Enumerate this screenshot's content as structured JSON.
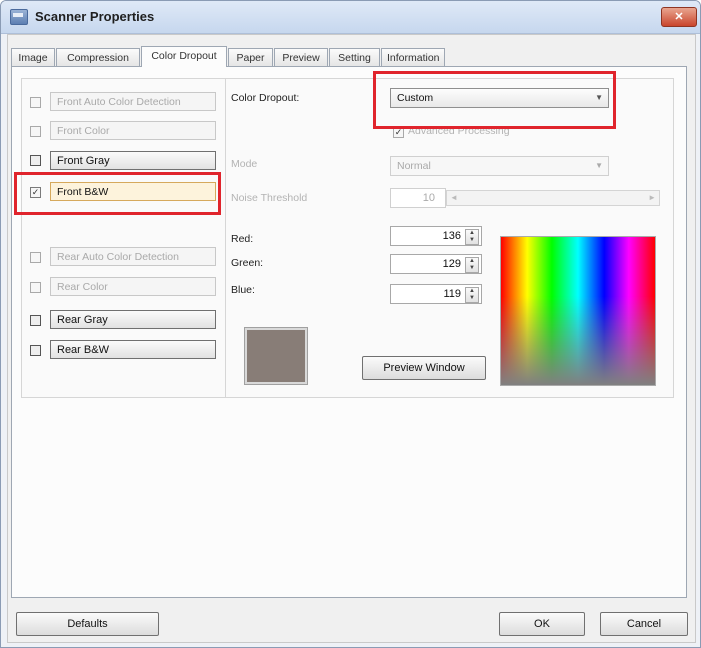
{
  "window": {
    "title": "Scanner Properties",
    "close_glyph": "✕"
  },
  "tabs": [
    {
      "label": "Image"
    },
    {
      "label": "Compression"
    },
    {
      "label": "Color Dropout"
    },
    {
      "label": "Paper"
    },
    {
      "label": "Preview"
    },
    {
      "label": "Setting"
    },
    {
      "label": "Information"
    }
  ],
  "active_tab": "Color Dropout",
  "left_options": [
    {
      "label": "Front Auto Color Detection",
      "checked": false,
      "enabled": false
    },
    {
      "label": "Front Color",
      "checked": false,
      "enabled": false
    },
    {
      "label": "Front Gray",
      "checked": false,
      "enabled": true
    },
    {
      "label": "Front B&W",
      "checked": true,
      "enabled": true,
      "selected": true
    },
    {
      "label": "Rear Auto Color Detection",
      "checked": false,
      "enabled": false
    },
    {
      "label": "Rear Color",
      "checked": false,
      "enabled": false
    },
    {
      "label": "Rear Gray",
      "checked": false,
      "enabled": true
    },
    {
      "label": "Rear B&W",
      "checked": false,
      "enabled": true
    }
  ],
  "checkmark": "✓",
  "dropout": {
    "label": "Color Dropout:",
    "value": "Custom",
    "advanced_label": "Advanced Processing",
    "mode_label": "Mode",
    "mode_value": "Normal",
    "threshold_label": "Noise Threshold",
    "threshold_value": "10"
  },
  "rgb": {
    "red_label": "Red:",
    "red_value": "136",
    "green_label": "Green:",
    "green_value": "129",
    "blue_label": "Blue:",
    "blue_value": "119"
  },
  "swatch_color": "#887d77",
  "preview_button": "Preview Window",
  "footer": {
    "defaults": "Defaults",
    "ok": "OK",
    "cancel": "Cancel"
  },
  "highlight_color": "#e0242c"
}
